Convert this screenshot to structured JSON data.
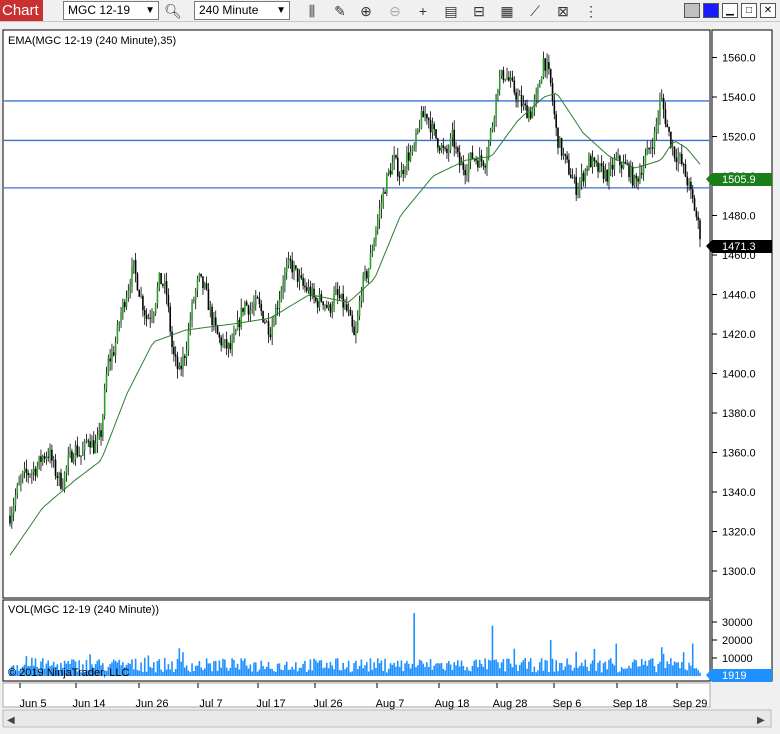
{
  "toolbar": {
    "chart_tab": "Chart",
    "instrument": "MGC 12-19",
    "interval": "240 Minute",
    "icons": [
      "bar-style-icon",
      "draw-icon",
      "zoom-in-icon",
      "zoom-out-icon",
      "crosshair-icon",
      "data-box-icon",
      "properties-icon",
      "strategies-icon",
      "indicators-icon",
      "templates-icon",
      "more-icon"
    ],
    "window_colors": [
      "#c0c0c0",
      "#1a1aff"
    ]
  },
  "price_panel": {
    "indicator_label": "EMA(MGC 12-19 (240 Minute),35)",
    "ema_value": "1505.9",
    "last_price": "1471.3"
  },
  "volume_panel": {
    "label": "VOL(MGC 12-19 (240 Minute))",
    "copyright": "© 2019 NinjaTrader, LLC",
    "last_volume": "1919"
  },
  "chart_data": [
    {
      "type": "candlestick",
      "title": "EMA(MGC 12-19 (240 Minute),35)",
      "ylim": [
        1290,
        1570
      ],
      "y_ticks": [
        "1300.0",
        "1320.0",
        "1340.0",
        "1360.0",
        "1380.0",
        "1400.0",
        "1420.0",
        "1440.0",
        "1460.0",
        "1480.0",
        "1500.0",
        "1520.0",
        "1540.0",
        "1560.0"
      ],
      "x_ticks": [
        "Jun 5",
        "Jun 14",
        "Jun 26",
        "Jul 7",
        "Jul 17",
        "Jul 26",
        "Aug 7",
        "Aug 18",
        "Aug 28",
        "Sep 6",
        "Sep 18",
        "Sep 29"
      ],
      "horizontal_lines": [
        1538,
        1518,
        1494
      ],
      "close_series": {
        "name": "MGC 12-19",
        "anchors": [
          [
            0,
            1328
          ],
          [
            1,
            1340
          ],
          [
            2,
            1348
          ],
          [
            3,
            1350
          ],
          [
            4,
            1352
          ],
          [
            5,
            1358
          ],
          [
            6,
            1360
          ],
          [
            7,
            1350
          ],
          [
            8,
            1344
          ],
          [
            9,
            1356
          ],
          [
            10,
            1362
          ],
          [
            11,
            1358
          ],
          [
            12,
            1368
          ],
          [
            13,
            1362
          ],
          [
            14,
            1370
          ],
          [
            15,
            1405
          ],
          [
            16,
            1412
          ],
          [
            17,
            1430
          ],
          [
            18,
            1442
          ],
          [
            19,
            1454
          ],
          [
            20,
            1440
          ],
          [
            21,
            1428
          ],
          [
            22,
            1432
          ],
          [
            23,
            1448
          ],
          [
            24,
            1442
          ],
          [
            25,
            1410
          ],
          [
            26,
            1400
          ],
          [
            27,
            1412
          ],
          [
            28,
            1434
          ],
          [
            29,
            1448
          ],
          [
            30,
            1442
          ],
          [
            31,
            1428
          ],
          [
            32,
            1418
          ],
          [
            33,
            1414
          ],
          [
            34,
            1412
          ],
          [
            35,
            1424
          ],
          [
            36,
            1436
          ],
          [
            37,
            1432
          ],
          [
            38,
            1436
          ],
          [
            39,
            1428
          ],
          [
            40,
            1422
          ],
          [
            41,
            1434
          ],
          [
            42,
            1448
          ],
          [
            43,
            1456
          ],
          [
            44,
            1450
          ],
          [
            45,
            1444
          ],
          [
            46,
            1442
          ],
          [
            47,
            1436
          ],
          [
            48,
            1438
          ],
          [
            49,
            1432
          ],
          [
            50,
            1440
          ],
          [
            51,
            1436
          ],
          [
            52,
            1430
          ],
          [
            53,
            1416
          ],
          [
            54,
            1444
          ],
          [
            55,
            1452
          ],
          [
            56,
            1470
          ],
          [
            57,
            1486
          ],
          [
            58,
            1500
          ],
          [
            59,
            1508
          ],
          [
            60,
            1500
          ],
          [
            61,
            1510
          ],
          [
            62,
            1512
          ],
          [
            63,
            1528
          ],
          [
            64,
            1532
          ],
          [
            65,
            1522
          ],
          [
            66,
            1516
          ],
          [
            67,
            1510
          ],
          [
            68,
            1520
          ],
          [
            69,
            1506
          ],
          [
            70,
            1504
          ],
          [
            71,
            1510
          ],
          [
            72,
            1508
          ],
          [
            73,
            1508
          ],
          [
            74,
            1524
          ],
          [
            75,
            1548
          ],
          [
            76,
            1552
          ],
          [
            77,
            1546
          ],
          [
            78,
            1540
          ],
          [
            79,
            1534
          ],
          [
            80,
            1532
          ],
          [
            81,
            1540
          ],
          [
            82,
            1560
          ],
          [
            83,
            1548
          ],
          [
            84,
            1520
          ],
          [
            85,
            1510
          ],
          [
            86,
            1502
          ],
          [
            87,
            1494
          ],
          [
            88,
            1500
          ],
          [
            89,
            1508
          ],
          [
            90,
            1504
          ],
          [
            91,
            1502
          ],
          [
            92,
            1500
          ],
          [
            93,
            1508
          ],
          [
            94,
            1506
          ],
          [
            95,
            1504
          ],
          [
            96,
            1496
          ],
          [
            97,
            1504
          ],
          [
            98,
            1512
          ],
          [
            99,
            1520
          ],
          [
            100,
            1540
          ],
          [
            101,
            1524
          ],
          [
            102,
            1512
          ],
          [
            103,
            1508
          ],
          [
            104,
            1498
          ],
          [
            105,
            1486
          ],
          [
            106,
            1471
          ]
        ]
      },
      "ema_series": {
        "name": "EMA(35)",
        "value": 1505.9,
        "anchors": [
          [
            0,
            1308
          ],
          [
            5,
            1332
          ],
          [
            10,
            1346
          ],
          [
            14,
            1356
          ],
          [
            18,
            1390
          ],
          [
            22,
            1416
          ],
          [
            27,
            1422
          ],
          [
            34,
            1425
          ],
          [
            40,
            1428
          ],
          [
            46,
            1440
          ],
          [
            52,
            1436
          ],
          [
            56,
            1448
          ],
          [
            60,
            1480
          ],
          [
            65,
            1500
          ],
          [
            70,
            1508
          ],
          [
            74,
            1510
          ],
          [
            78,
            1528
          ],
          [
            82,
            1540
          ],
          [
            84,
            1542
          ],
          [
            88,
            1522
          ],
          [
            92,
            1510
          ],
          [
            96,
            1504
          ],
          [
            100,
            1508
          ],
          [
            102,
            1518
          ],
          [
            104,
            1514
          ],
          [
            106,
            1505.9
          ]
        ]
      }
    },
    {
      "type": "bar",
      "title": "VOL(MGC 12-19 (240 Minute))",
      "ylim": [
        0,
        36000
      ],
      "y_ticks": [
        "10000",
        "20000",
        "30000"
      ],
      "last_value": 1919,
      "typical_range": [
        2000,
        10000
      ],
      "spikes": [
        [
          62,
          35000
        ],
        [
          74,
          28000
        ],
        [
          83,
          20000
        ],
        [
          93,
          18000
        ],
        [
          100,
          16000
        ],
        [
          105,
          18000
        ]
      ]
    }
  ]
}
